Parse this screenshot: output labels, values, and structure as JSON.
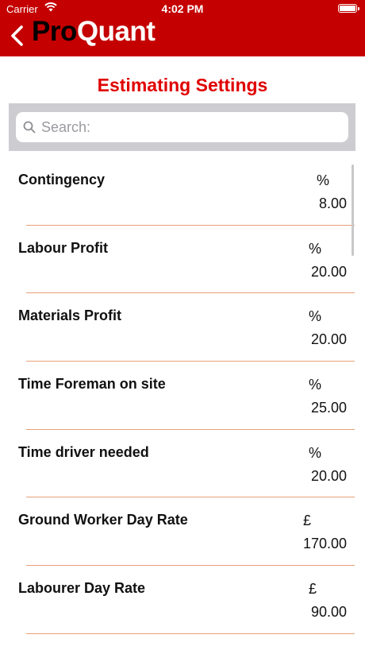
{
  "status_bar": {
    "carrier": "Carrier",
    "time": "4:02 PM"
  },
  "nav": {
    "logo_pro": "Pro",
    "logo_quant": "Quant"
  },
  "page_title": "Estimating Settings",
  "search": {
    "placeholder": "Search:",
    "value": ""
  },
  "settings": [
    {
      "label": "Contingency",
      "unit": "%",
      "value": "8.00"
    },
    {
      "label": "Labour Profit",
      "unit": "%",
      "value": "20.00"
    },
    {
      "label": "Materials Profit",
      "unit": "%",
      "value": "20.00"
    },
    {
      "label": "Time Foreman on site",
      "unit": "%",
      "value": "25.00"
    },
    {
      "label": "Time driver needed",
      "unit": "%",
      "value": "20.00"
    },
    {
      "label": "Ground Worker Day Rate",
      "unit": "£",
      "value": "170.00"
    },
    {
      "label": "Labourer Day Rate",
      "unit": "£",
      "value": "90.00"
    }
  ],
  "colors": {
    "brand_red": "#c40000",
    "title_red": "#e00000",
    "separator": "#e8a07a"
  }
}
